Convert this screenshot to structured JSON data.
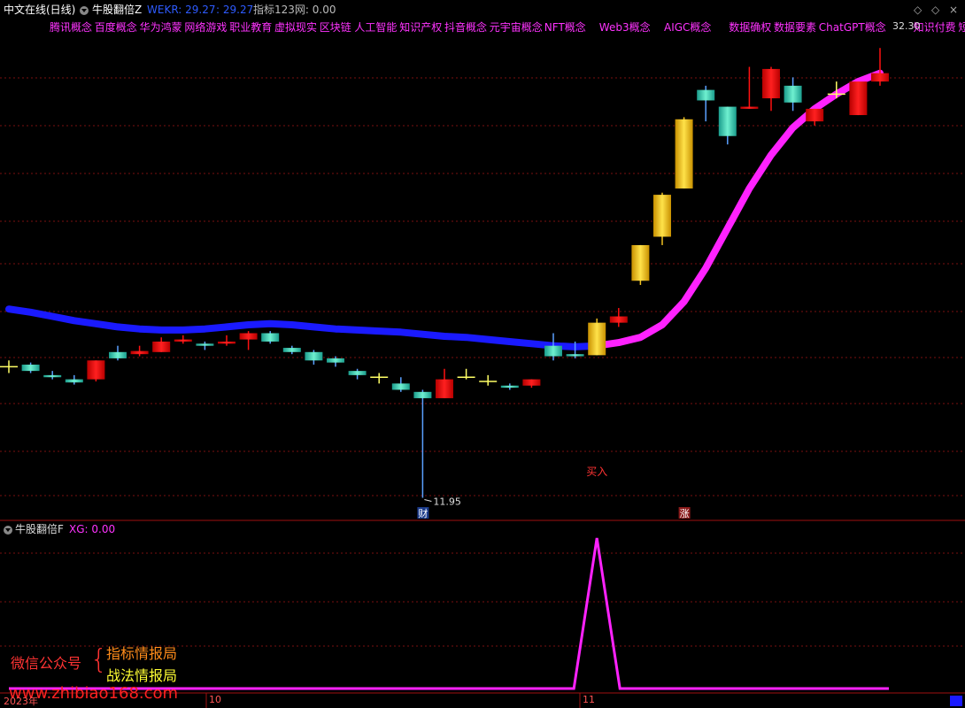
{
  "header": {
    "app_title": "中文在线(日线)",
    "indicator_name": "牛股翻倍Z",
    "wekr_label": "WEKR: 29.27",
    "second_value": ": 29.27",
    "metric_label": "指标123网: 0.00"
  },
  "concept_tags": [
    "腾讯概念",
    "百度概念",
    "华为鸿蒙",
    "网络游戏",
    "职业教育",
    "虚拟现实",
    "区块链",
    "人工智能",
    "知识产权",
    "抖音概念",
    "元宇宙概念",
    "NFT概念",
    "Web3概念",
    "AIGC概念",
    "数据确权",
    "数据要素",
    "ChatGPT概念",
    "知识付费",
    "短剧游戏"
  ],
  "price_labels": {
    "high": "32.30",
    "low": "11.95",
    "buy_signal": "买入",
    "fin_marker": "财",
    "rise_marker": "涨"
  },
  "sub_panel": {
    "indicator_name": "牛股翻倍F",
    "xg_label": "XG: 0.00"
  },
  "axis": {
    "year_label": "2023年",
    "month_oct": "10",
    "month_nov": "11"
  },
  "watermark": {
    "wechat_label": "微信公众号",
    "brace": "{",
    "line1": "指标情报局",
    "line2": "战法情报局",
    "site": "www.zhibiao168.com"
  },
  "colors": {
    "up": "#ff1010",
    "down": "#2ed3b0",
    "gold": "#f0c020",
    "ma_before": "#1a1aff",
    "ma_after": "#ff22ff",
    "grid": "#7a1010",
    "xg_line": "#ff22ff"
  },
  "chart_data": {
    "type": "candlestick",
    "price_range": [
      11.0,
      34.0
    ],
    "candles": [
      {
        "o": 18.2,
        "c": 18.2,
        "h": 18.5,
        "l": 17.9,
        "kind": "doji"
      },
      {
        "o": 18.3,
        "c": 18.0,
        "h": 18.4,
        "l": 17.9,
        "kind": "down"
      },
      {
        "o": 17.8,
        "c": 17.7,
        "h": 18.0,
        "l": 17.6,
        "kind": "down"
      },
      {
        "o": 17.6,
        "c": 17.45,
        "h": 17.8,
        "l": 17.35,
        "kind": "down"
      },
      {
        "o": 17.6,
        "c": 18.5,
        "h": 18.5,
        "l": 17.5,
        "kind": "up"
      },
      {
        "o": 18.9,
        "c": 18.6,
        "h": 19.2,
        "l": 18.5,
        "kind": "down"
      },
      {
        "o": 18.8,
        "c": 18.95,
        "h": 19.2,
        "l": 18.7,
        "kind": "up"
      },
      {
        "o": 18.9,
        "c": 19.4,
        "h": 19.6,
        "l": 18.9,
        "kind": "up"
      },
      {
        "o": 19.4,
        "c": 19.5,
        "h": 19.7,
        "l": 19.3,
        "kind": "up"
      },
      {
        "o": 19.3,
        "c": 19.2,
        "h": 19.4,
        "l": 19.0,
        "kind": "down"
      },
      {
        "o": 19.3,
        "c": 19.4,
        "h": 19.7,
        "l": 19.2,
        "kind": "up"
      },
      {
        "o": 19.5,
        "c": 19.8,
        "h": 19.9,
        "l": 19.0,
        "kind": "up"
      },
      {
        "o": 19.8,
        "c": 19.4,
        "h": 19.9,
        "l": 19.3,
        "kind": "down"
      },
      {
        "o": 19.1,
        "c": 18.9,
        "h": 19.2,
        "l": 18.8,
        "kind": "down"
      },
      {
        "o": 18.9,
        "c": 18.5,
        "h": 19.0,
        "l": 18.3,
        "kind": "down"
      },
      {
        "o": 18.6,
        "c": 18.4,
        "h": 18.7,
        "l": 18.2,
        "kind": "down"
      },
      {
        "o": 18.0,
        "c": 17.8,
        "h": 18.1,
        "l": 17.6,
        "kind": "down"
      },
      {
        "o": 17.7,
        "c": 17.7,
        "h": 17.9,
        "l": 17.4,
        "kind": "doji"
      },
      {
        "o": 17.4,
        "c": 17.1,
        "h": 17.7,
        "l": 17.0,
        "kind": "down"
      },
      {
        "o": 17.0,
        "c": 16.7,
        "h": 17.1,
        "l": 11.95,
        "kind": "down"
      },
      {
        "o": 16.7,
        "c": 17.6,
        "h": 18.1,
        "l": 16.7,
        "kind": "up"
      },
      {
        "o": 17.7,
        "c": 17.7,
        "h": 18.1,
        "l": 17.6,
        "kind": "doji"
      },
      {
        "o": 17.5,
        "c": 17.5,
        "h": 17.8,
        "l": 17.3,
        "kind": "doji"
      },
      {
        "o": 17.3,
        "c": 17.2,
        "h": 17.4,
        "l": 17.1,
        "kind": "down"
      },
      {
        "o": 17.3,
        "c": 17.6,
        "h": 17.6,
        "l": 17.2,
        "kind": "up"
      },
      {
        "o": 19.2,
        "c": 18.7,
        "h": 19.8,
        "l": 18.5,
        "kind": "down"
      },
      {
        "o": 18.8,
        "c": 18.7,
        "h": 19.4,
        "l": 18.6,
        "kind": "down"
      },
      {
        "o": 18.75,
        "c": 20.3,
        "h": 20.5,
        "l": 18.75,
        "kind": "gold"
      },
      {
        "o": 20.3,
        "c": 20.6,
        "h": 21.0,
        "l": 20.1,
        "kind": "up"
      },
      {
        "o": 22.3,
        "c": 24.0,
        "h": 24.0,
        "l": 22.1,
        "kind": "gold"
      },
      {
        "o": 24.4,
        "c": 26.4,
        "h": 26.5,
        "l": 24.0,
        "kind": "gold"
      },
      {
        "o": 26.7,
        "c": 30.0,
        "h": 30.1,
        "l": 26.7,
        "kind": "gold"
      },
      {
        "o": 31.4,
        "c": 30.9,
        "h": 31.6,
        "l": 29.9,
        "kind": "down"
      },
      {
        "o": 30.6,
        "c": 29.2,
        "h": 30.6,
        "l": 28.8,
        "kind": "down"
      },
      {
        "o": 30.5,
        "c": 30.6,
        "h": 32.5,
        "l": 30.5,
        "kind": "up"
      },
      {
        "o": 31.0,
        "c": 32.4,
        "h": 32.5,
        "l": 30.4,
        "kind": "up"
      },
      {
        "o": 31.6,
        "c": 30.8,
        "h": 32.0,
        "l": 30.4,
        "kind": "down"
      },
      {
        "o": 29.9,
        "c": 30.5,
        "h": 30.5,
        "l": 29.7,
        "kind": "up"
      },
      {
        "o": 31.2,
        "c": 31.2,
        "h": 31.8,
        "l": 31.0,
        "kind": "doji"
      },
      {
        "o": 30.2,
        "c": 31.8,
        "h": 31.8,
        "l": 30.2,
        "kind": "up"
      },
      {
        "o": 31.8,
        "c": 32.2,
        "h": 33.4,
        "l": 31.6,
        "kind": "up"
      }
    ],
    "ma_line": [
      20.95,
      20.8,
      20.6,
      20.4,
      20.25,
      20.1,
      20.0,
      19.95,
      19.95,
      20.0,
      20.1,
      20.2,
      20.25,
      20.2,
      20.1,
      20.0,
      19.95,
      19.9,
      19.85,
      19.75,
      19.65,
      19.6,
      19.5,
      19.4,
      19.3,
      19.2,
      19.15,
      19.2,
      19.35,
      19.6,
      20.2,
      21.3,
      22.9,
      24.8,
      26.7,
      28.3,
      29.6,
      30.5,
      31.2,
      31.8,
      32.2
    ],
    "ma_color_switch_index": 27,
    "xg_signal": {
      "index": 27,
      "value": 1,
      "baseline": 0
    }
  }
}
